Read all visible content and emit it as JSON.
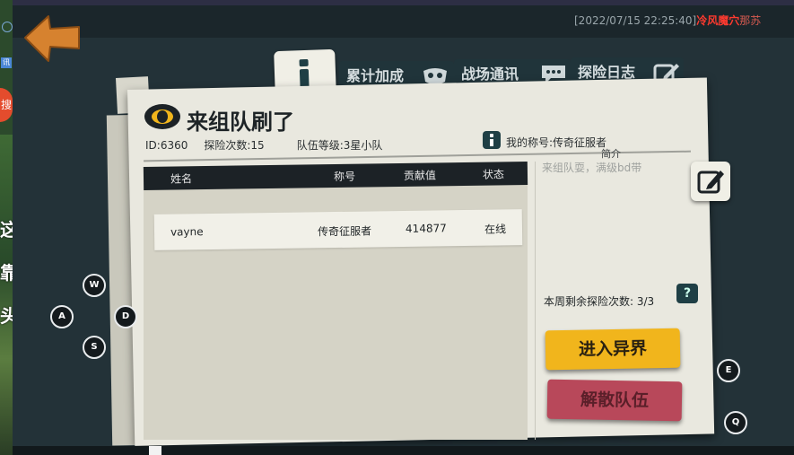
{
  "browser": {
    "search_badge": "搜",
    "side_text": [
      "这",
      "靠",
      "头"
    ],
    "side_icon_label": "讯"
  },
  "chat": {
    "timestamp": "[2022/07/15 22:25:40]",
    "speaker": "冷风魔穴",
    "message": "那苏"
  },
  "tabs": [
    {
      "label": "",
      "icon": "info-icon",
      "active": true
    },
    {
      "label": "累计加成",
      "icon": "mask-icon"
    },
    {
      "label": "战场通讯",
      "icon": "chat-bubble-icon"
    },
    {
      "label": "探险日志",
      "icon": "pencil-icon"
    }
  ],
  "team": {
    "title": "来组队刷了",
    "id": "ID:6360",
    "explore_count": "探险次数:15",
    "team_level": "队伍等级:3星小队",
    "my_title": "我的称号:传奇征服者"
  },
  "table": {
    "headers": [
      "姓名",
      "称号",
      "贡献值",
      "状态"
    ],
    "rows": [
      {
        "name": "vayne",
        "title": "传奇征服者",
        "contribution": "414877",
        "status": "在线"
      }
    ]
  },
  "intro": {
    "label": "简介",
    "text": "来组队耍，满级bd带"
  },
  "weekly": {
    "remaining": "本周剩余探险次数: 3/3",
    "help": "?"
  },
  "actions": {
    "enter": "进入异界",
    "disband": "解散队伍"
  },
  "keys": {
    "w": "W",
    "a": "A",
    "s": "S",
    "d": "D",
    "e": "E",
    "q": "Q"
  },
  "colors": {
    "accent_yellow": "#f1b51c",
    "accent_red": "#b8485a",
    "back_arrow": "#d6822f",
    "paper": "#e9e8df",
    "header_dark": "#1c2226"
  }
}
